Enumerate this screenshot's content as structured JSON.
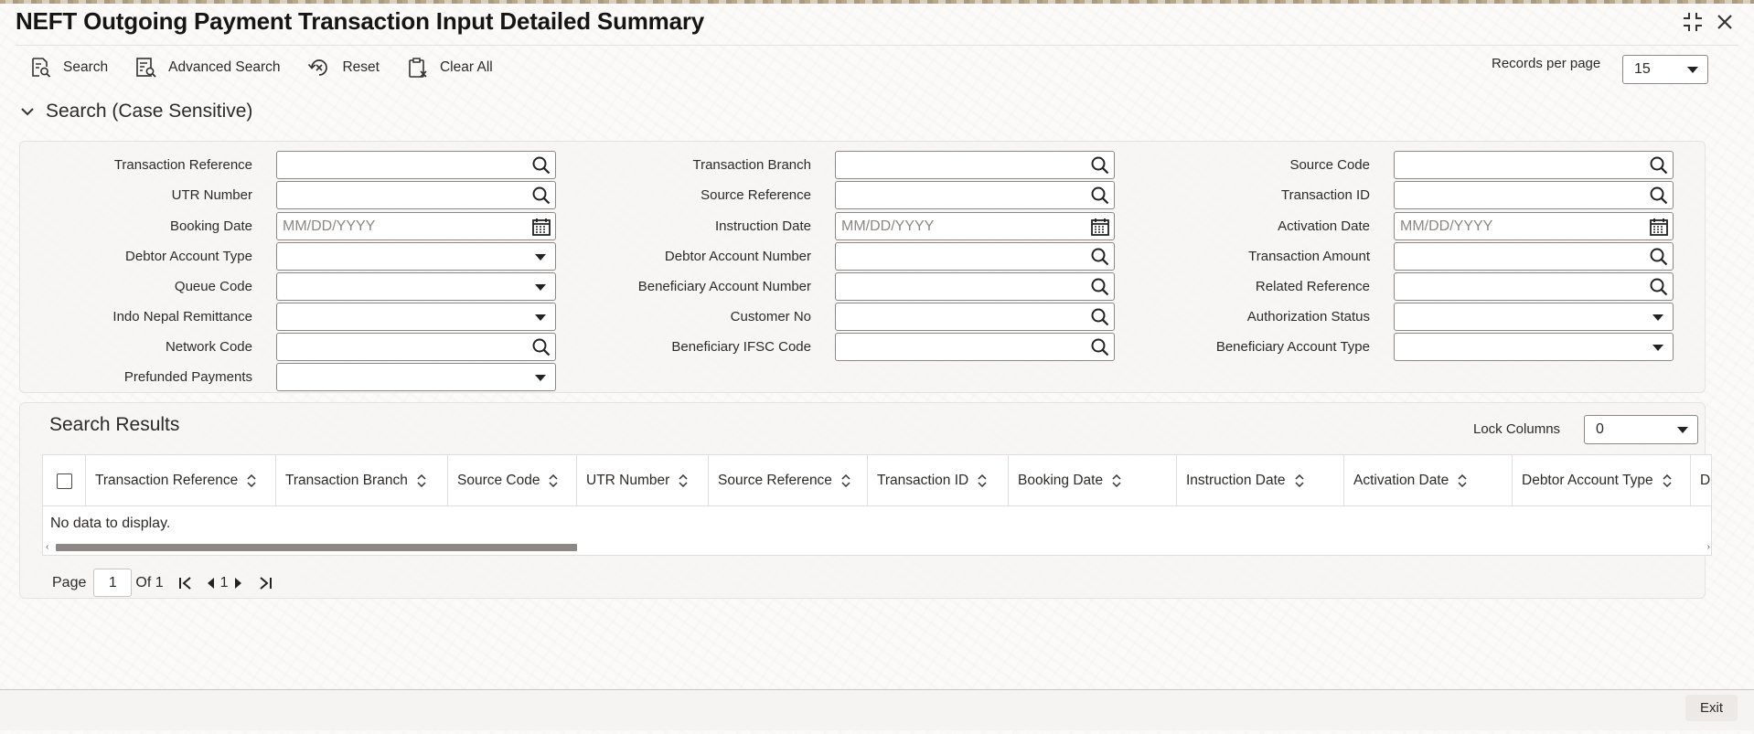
{
  "window": {
    "title": "NEFT Outgoing Payment Transaction Input Detailed Summary"
  },
  "toolbar": {
    "search_label": "Search",
    "advanced_search_label": "Advanced Search",
    "reset_label": "Reset",
    "clear_all_label": "Clear All",
    "records_per_page_label": "Records per page",
    "records_per_page_value": "15"
  },
  "search_section": {
    "title": "Search (Case Sensitive)",
    "fields": {
      "transaction_reference": {
        "label": "Transaction Reference",
        "value": ""
      },
      "utr_number": {
        "label": "UTR Number",
        "value": ""
      },
      "booking_date": {
        "label": "Booking Date",
        "placeholder": "MM/DD/YYYY"
      },
      "debtor_account_type": {
        "label": "Debtor Account Type",
        "value": ""
      },
      "queue_code": {
        "label": "Queue Code",
        "value": ""
      },
      "indo_nepal_remittance": {
        "label": "Indo Nepal Remittance",
        "value": ""
      },
      "network_code": {
        "label": "Network Code",
        "value": ""
      },
      "prefunded_payments": {
        "label": "Prefunded Payments",
        "value": ""
      },
      "transaction_branch": {
        "label": "Transaction Branch",
        "value": ""
      },
      "source_reference": {
        "label": "Source Reference",
        "value": ""
      },
      "instruction_date": {
        "label": "Instruction Date",
        "placeholder": "MM/DD/YYYY"
      },
      "debtor_account_number": {
        "label": "Debtor Account Number",
        "value": ""
      },
      "beneficiary_account_number": {
        "label": "Beneficiary Account Number",
        "value": ""
      },
      "customer_no": {
        "label": "Customer No",
        "value": ""
      },
      "beneficiary_ifsc_code": {
        "label": "Beneficiary IFSC Code",
        "value": ""
      },
      "source_code": {
        "label": "Source Code",
        "value": ""
      },
      "transaction_id": {
        "label": "Transaction ID",
        "value": ""
      },
      "activation_date": {
        "label": "Activation Date",
        "placeholder": "MM/DD/YYYY"
      },
      "transaction_amount": {
        "label": "Transaction Amount",
        "value": ""
      },
      "related_reference": {
        "label": "Related Reference",
        "value": ""
      },
      "authorization_status": {
        "label": "Authorization Status",
        "value": ""
      },
      "beneficiary_account_type": {
        "label": "Beneficiary Account Type",
        "value": ""
      }
    }
  },
  "results": {
    "title": "Search Results",
    "lock_columns_label": "Lock Columns",
    "lock_columns_value": "0",
    "columns": [
      "Transaction Reference",
      "Transaction Branch",
      "Source Code",
      "UTR Number",
      "Source Reference",
      "Transaction ID",
      "Booking Date",
      "Instruction Date",
      "Activation Date",
      "Debtor Account Type",
      "De"
    ],
    "empty_message": "No data to display."
  },
  "pagination": {
    "page_label": "Page",
    "page_value": "1",
    "of_label": "Of 1",
    "current_page": "1"
  },
  "footer": {
    "exit_label": "Exit"
  },
  "icons": {
    "maximize": "maximize-icon",
    "close": "close-icon",
    "search": "search-icon",
    "calendar": "calendar-icon"
  }
}
